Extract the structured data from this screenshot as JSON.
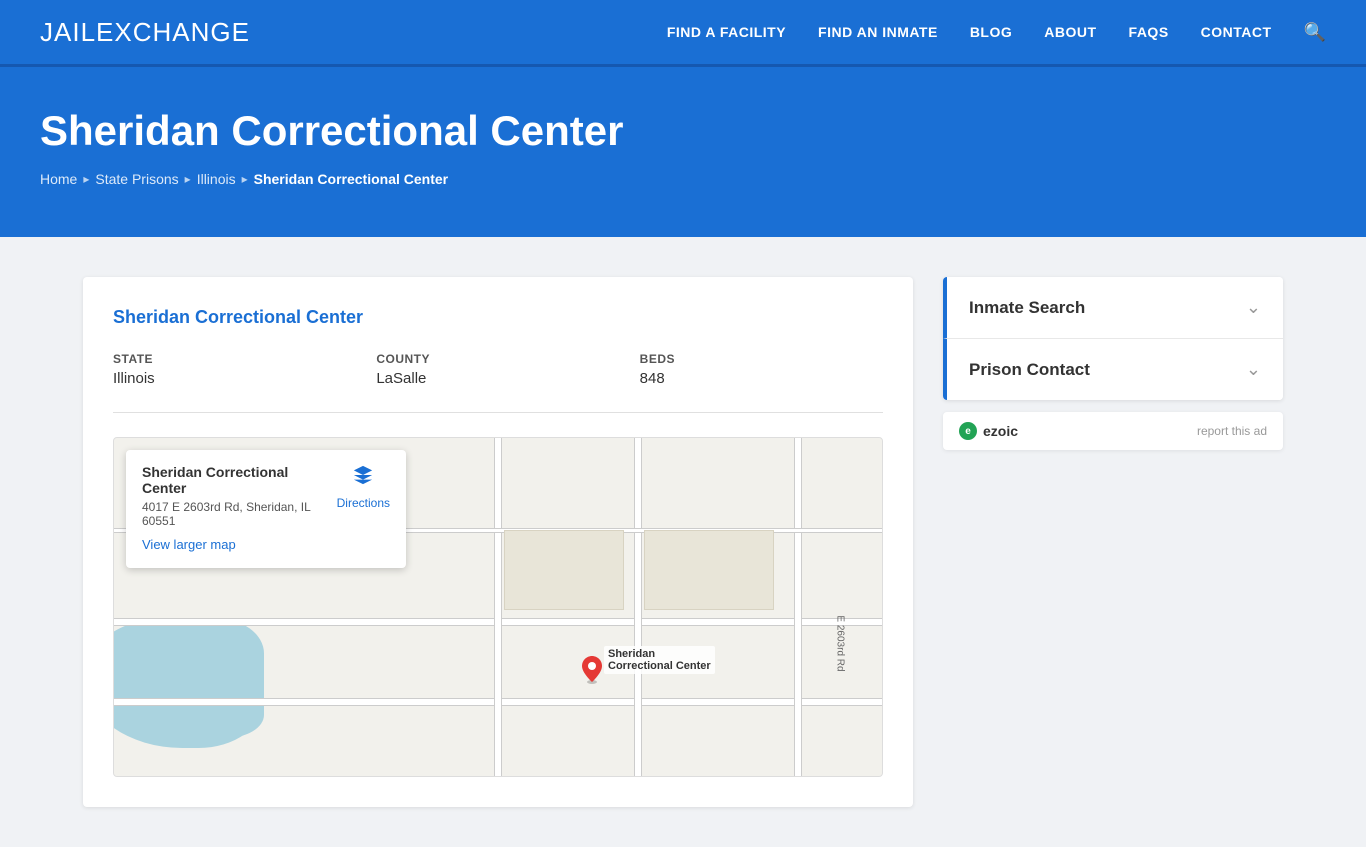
{
  "site": {
    "logo_jail": "JAIL",
    "logo_exchange": "EXCHANGE"
  },
  "nav": {
    "items": [
      {
        "label": "FIND A FACILITY",
        "href": "#"
      },
      {
        "label": "FIND AN INMATE",
        "href": "#"
      },
      {
        "label": "BLOG",
        "href": "#"
      },
      {
        "label": "ABOUT",
        "href": "#"
      },
      {
        "label": "FAQs",
        "href": "#"
      },
      {
        "label": "CONTACT",
        "href": "#"
      }
    ]
  },
  "hero": {
    "title": "Sheridan Correctional Center",
    "breadcrumb": {
      "home": "Home",
      "state_prisons": "State Prisons",
      "state": "Illinois",
      "current": "Sheridan Correctional Center"
    }
  },
  "facility": {
    "title": "Sheridan Correctional Center",
    "state_label": "STATE",
    "state_value": "Illinois",
    "county_label": "COUNTY",
    "county_value": "LaSalle",
    "beds_label": "BEDS",
    "beds_value": "848"
  },
  "map": {
    "facility_name": "Sheridan Correctional Center",
    "address": "4017 E 2603rd Rd, Sheridan, IL 60551",
    "directions_label": "Directions",
    "view_larger": "View larger map",
    "road_label": "E 2603rd Rd",
    "pin_label_line1": "Sheridan",
    "pin_label_line2": "Correctional Center"
  },
  "sidebar": {
    "inmate_search": "Inmate Search",
    "prison_contact": "Prison Contact"
  },
  "ezoic": {
    "label": "ezoic",
    "report": "report this ad"
  }
}
